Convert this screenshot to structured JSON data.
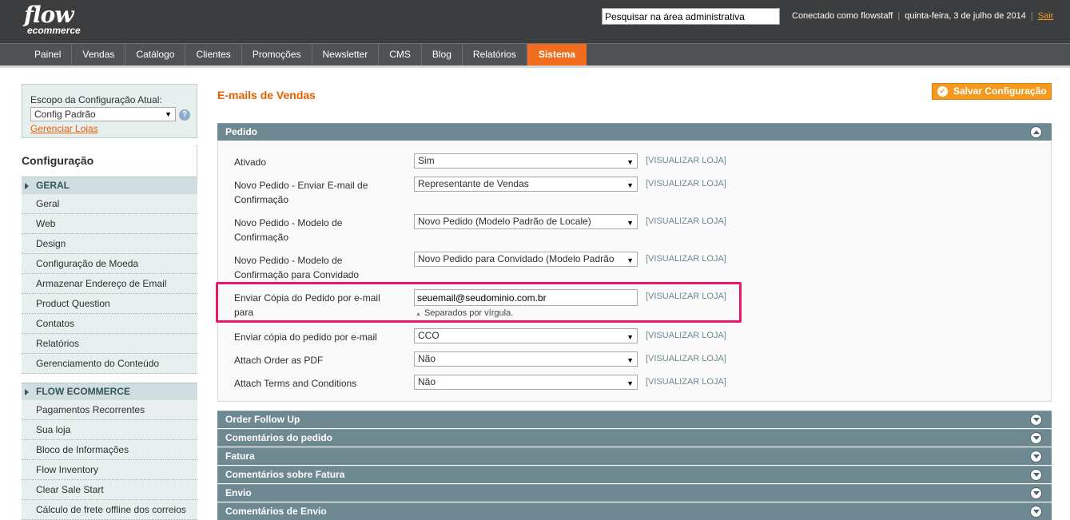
{
  "header": {
    "logo_main": "flow",
    "logo_sub": "ecommerce",
    "search_value": "Pesquisar na área administrativa",
    "user_text": "Conectado como flowstaff",
    "date_text": "quinta-feira, 3 de julho de 2014",
    "logout_label": "Sair"
  },
  "nav": {
    "items": [
      "Painel",
      "Vendas",
      "Catálogo",
      "Clientes",
      "Promoções",
      "Newsletter",
      "CMS",
      "Blog",
      "Relatórios",
      "Sistema"
    ],
    "active": "Sistema"
  },
  "scope": {
    "label": "Escopo da Configuração Atual:",
    "selected": "Config Padrão",
    "manage_link": "Gerenciar Lojas"
  },
  "sidebar": {
    "title": "Configuração",
    "groups": [
      {
        "label": "GERAL",
        "items": [
          "Geral",
          "Web",
          "Design",
          "Configuração de Moeda",
          "Armazenar Endereço de Email",
          "Product Question",
          "Contatos",
          "Relatórios",
          "Gerenciamento do Conteúdo"
        ]
      },
      {
        "label": "FLOW ECOMMERCE",
        "items": [
          "Pagamentos Recorrentes",
          "Sua loja",
          "Bloco de Informações",
          "Flow Inventory",
          "Clear Sale Start",
          "Cálculo de frete offline dos correios"
        ]
      }
    ]
  },
  "main": {
    "title": "E-mails de Vendas",
    "save_label": "Salvar Configuração",
    "section_open": "Pedido",
    "scope_tag": "[VISUALIZAR LOJA]",
    "fields": [
      {
        "label": "Ativado",
        "value": "Sim",
        "type": "select"
      },
      {
        "label": "Novo Pedido - Enviar E-mail de Confirmação",
        "value": "Representante de Vendas",
        "type": "select"
      },
      {
        "label": "Novo Pedido - Modelo de Confirmação",
        "value": "Novo Pedido (Modelo Padrão de Locale)",
        "type": "select"
      },
      {
        "label": "Novo Pedido - Modelo de Confirmação para Convidado",
        "value": "Novo Pedido para Convidado (Modelo Padrão",
        "type": "select"
      },
      {
        "label": "Enviar Cópia do Pedido por e-mail para",
        "value": "seuemail@seudominio.com.br",
        "type": "input",
        "note": "Separados por vírgula."
      },
      {
        "label": "Enviar cópia do pedido por e-mail",
        "value": "CCO",
        "type": "select"
      },
      {
        "label": "Attach Order as PDF",
        "value": "Não",
        "type": "select"
      },
      {
        "label": "Attach Terms and Conditions",
        "value": "Não",
        "type": "select"
      }
    ],
    "collapsed_sections": [
      "Order Follow Up",
      "Comentários do pedido",
      "Fatura",
      "Comentários sobre Fatura",
      "Envio",
      "Comentários de Envio"
    ]
  },
  "colors": {
    "accent": "#f26c1f",
    "header_bg": "#3b3d3f",
    "section_bg": "#6f8992",
    "highlight": "#e8196a"
  }
}
